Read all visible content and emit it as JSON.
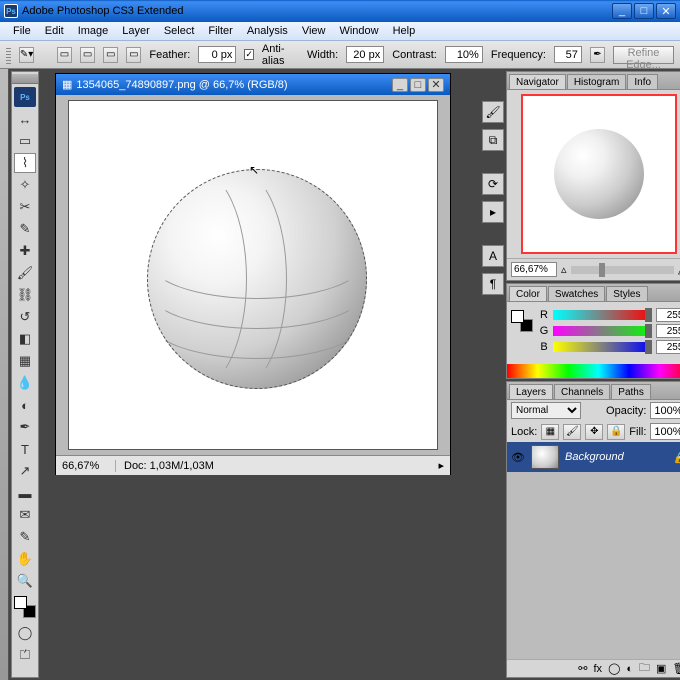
{
  "title": "Adobe Photoshop CS3 Extended",
  "menus": [
    "File",
    "Edit",
    "Image",
    "Layer",
    "Select",
    "Filter",
    "Analysis",
    "View",
    "Window",
    "Help"
  ],
  "options": {
    "feather_label": "Feather:",
    "feather": "0 px",
    "aa": "Anti-alias",
    "width_label": "Width:",
    "width": "20 px",
    "contrast_label": "Contrast:",
    "contrast": "10%",
    "frequency_label": "Frequency:",
    "frequency": "57",
    "refine": "Refine Edge..."
  },
  "doc": {
    "title": "1354065_74890897.png @ 66,7% (RGB/8)",
    "zoom": "66,67%",
    "status": "Doc: 1,03M/1,03M"
  },
  "nav": {
    "tabs": [
      "Navigator",
      "Histogram",
      "Info"
    ],
    "zoom": "66,67%"
  },
  "color": {
    "tabs": [
      "Color",
      "Swatches",
      "Styles"
    ],
    "r": "255",
    "g": "255",
    "b": "255"
  },
  "layers": {
    "tabs": [
      "Layers",
      "Channels",
      "Paths"
    ],
    "mode": "Normal",
    "opacity_lab": "Opacity:",
    "opacity": "100%",
    "lock_lab": "Lock:",
    "fill_lab": "Fill:",
    "fill": "100%",
    "bg": "Background"
  }
}
